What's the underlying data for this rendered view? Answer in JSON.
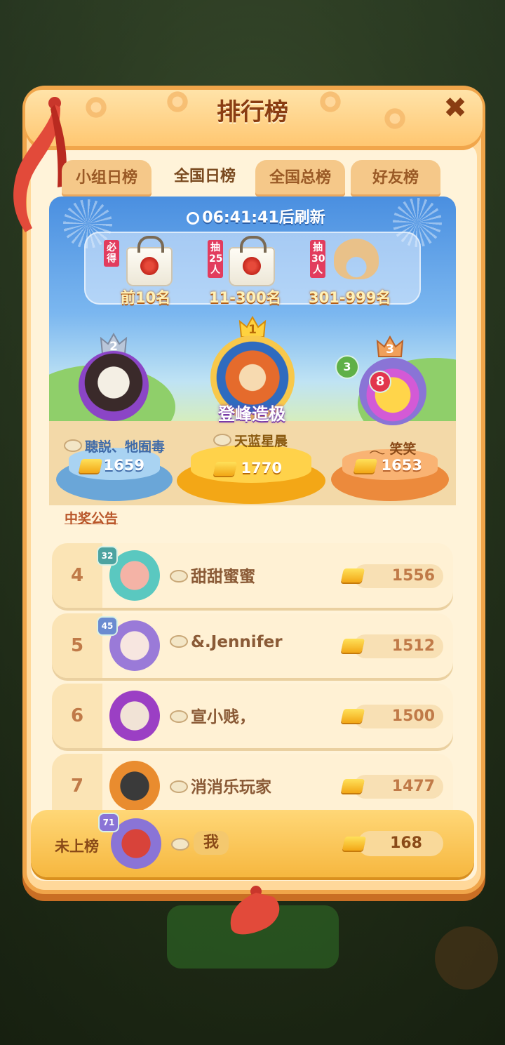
{
  "title": "排行榜",
  "close_icon": "close-icon",
  "tabs": [
    {
      "label": "小组日榜",
      "active": false
    },
    {
      "label": "全国日榜",
      "active": true
    },
    {
      "label": "全国总榜",
      "active": false
    },
    {
      "label": "好友榜",
      "active": false
    }
  ],
  "timer": {
    "time": "06:41:41",
    "suffix": "后刷新"
  },
  "prizes": [
    {
      "tag": "必得",
      "range": "前10名",
      "item": "tote-bag"
    },
    {
      "tag": "抽25人",
      "range": "11-300名",
      "item": "tote-bag"
    },
    {
      "tag": "抽30人",
      "range": "301-999名",
      "item": "neck-pillow"
    }
  ],
  "podium": [
    {
      "rank": "2",
      "name": "聴説、牠囿毒",
      "score": "1659"
    },
    {
      "rank": "1",
      "name": "天蓝星晨",
      "score": "1770",
      "badge": "登峰造极"
    },
    {
      "rank": "3",
      "name": "𓂃 笑笑",
      "score": "1653",
      "frame_level": "3",
      "frame_num": "8"
    }
  ],
  "notice": "中奖公告",
  "rows": [
    {
      "rank": "4",
      "name": "甜甜蜜蜜",
      "score": "1556",
      "level": "32"
    },
    {
      "rank": "5",
      "name": "&.Jennifer",
      "score": "1512",
      "level": "45"
    },
    {
      "rank": "6",
      "name": "宣小贱，",
      "score": "1500",
      "level": ""
    },
    {
      "rank": "7",
      "name": "消消乐玩家",
      "score": "1477",
      "level": ""
    }
  ],
  "me": {
    "status": "未上榜",
    "name": "我",
    "score": "168",
    "level": "71"
  },
  "colors": {
    "panel": "#ffd89a",
    "accent": "#8a3d12",
    "gold": "#f2a716"
  }
}
